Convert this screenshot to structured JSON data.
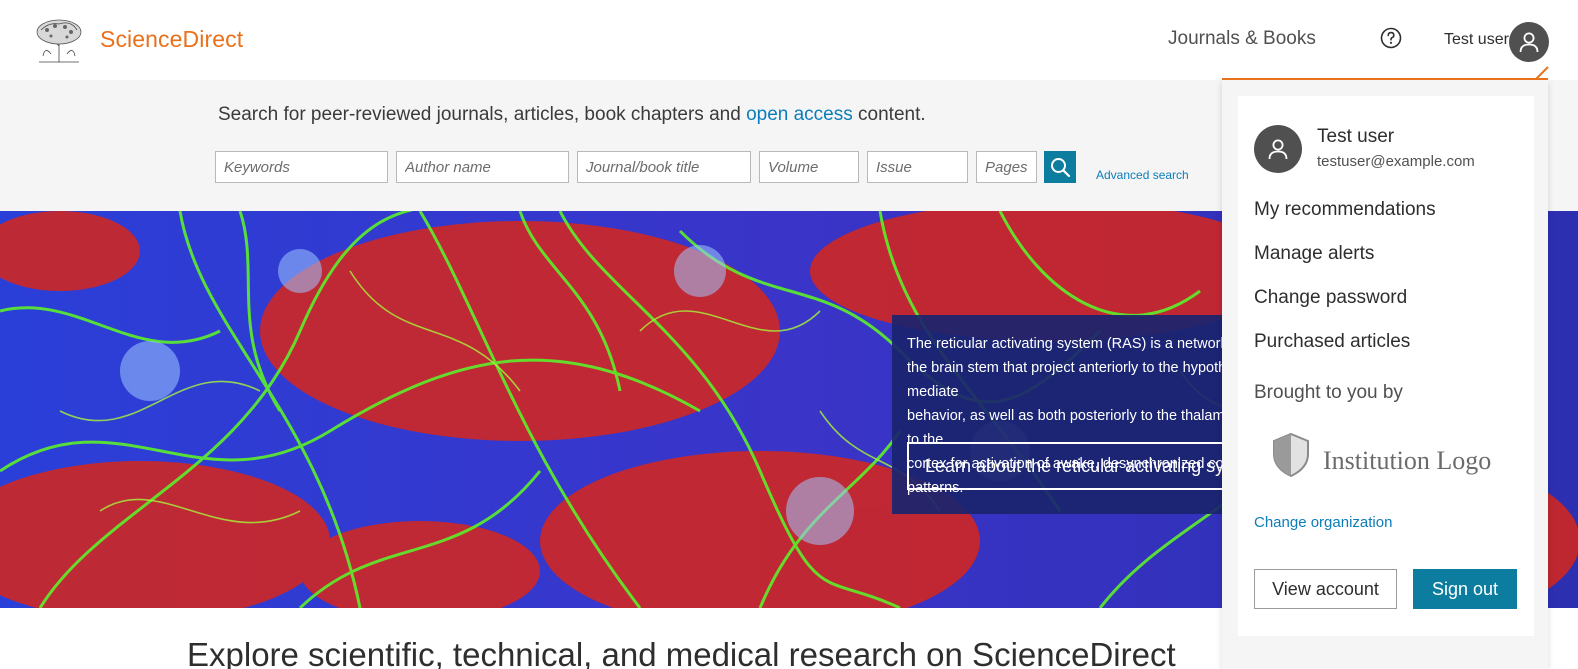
{
  "header": {
    "brand": "ScienceDirect",
    "nav_journals_books": "Journals & Books",
    "user_name": "Test user"
  },
  "search": {
    "intro_before": "Search for peer-reviewed journals, articles, book chapters and ",
    "intro_link": "open access",
    "intro_after": " content.",
    "fields": {
      "keywords": "Keywords",
      "author": "Author name",
      "journal": "Journal/book title",
      "volume": "Volume",
      "issue": "Issue",
      "pages": "Pages"
    },
    "advanced_link": "Advanced search"
  },
  "hero": {
    "text_lines": "The reticular activating system (RAS) is a network of\nthe brain stem that project anteriorly to the hypothalamus to mediate\nbehavior, as well as both posteriorly to the thalamus and directly to the\ncortex for activation of awake, desynchronized cortical EEG patterns.",
    "cta_label": "Learn about the reticular activating system"
  },
  "explore_heading": "Explore scientific, technical, and medical research on ScienceDirect",
  "account_menu": {
    "name": "Test user",
    "email": "testuser@example.com",
    "items": [
      "My recommendations",
      "Manage alerts",
      "Change password",
      "Purchased articles"
    ],
    "brought_by": "Brought to you by",
    "institution_logo_text": "Institution Logo",
    "change_org": "Change organization",
    "view_account": "View account",
    "sign_out": "Sign out"
  },
  "colors": {
    "brand_orange": "#e9711c",
    "link_blue": "#0c7dbb",
    "primary_button": "#0c7c9f",
    "hero_card": "#1a246e"
  },
  "icons": [
    "elsevier-tree-logo",
    "help-icon",
    "user-avatar-icon",
    "search-icon",
    "shield-icon"
  ]
}
